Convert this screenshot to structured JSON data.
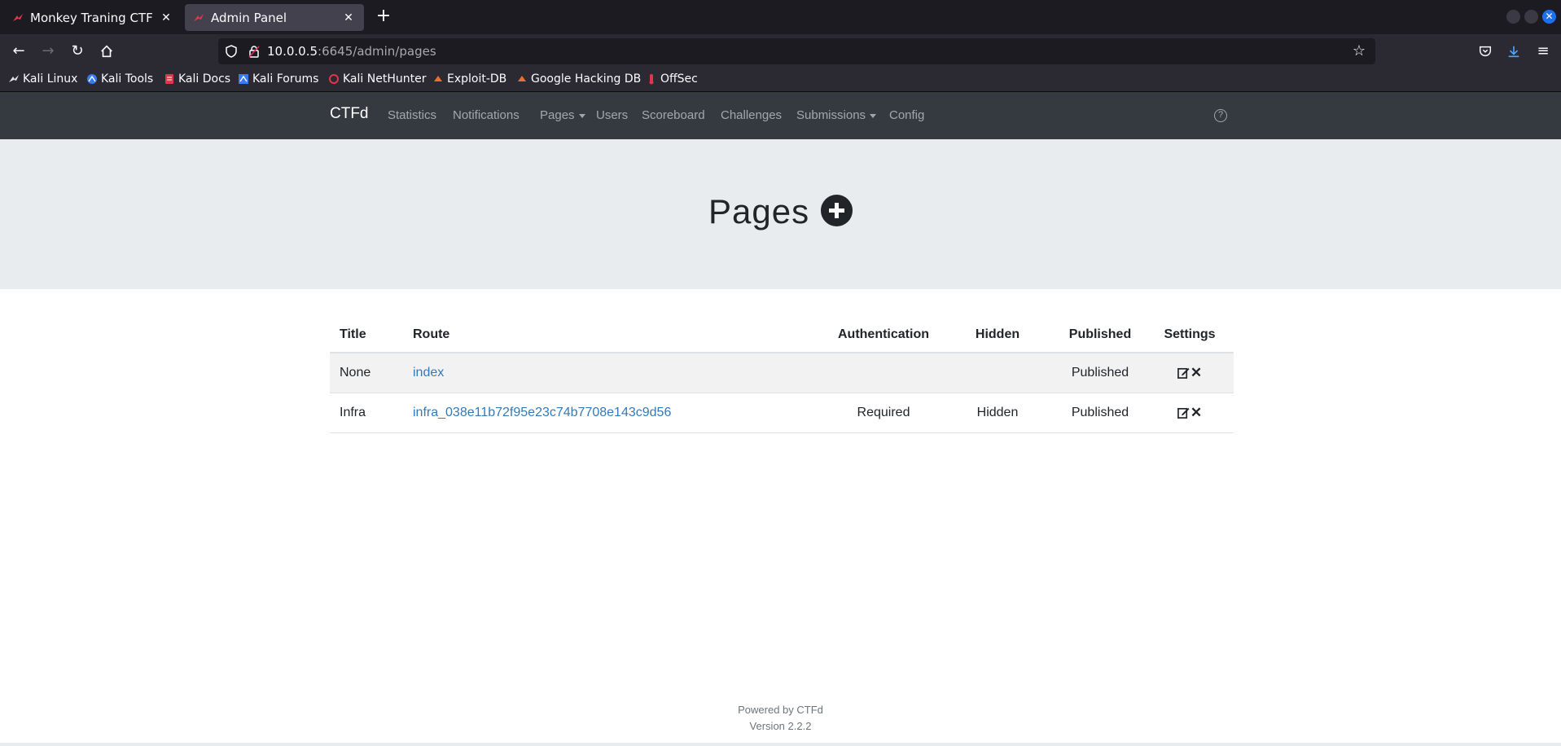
{
  "browser": {
    "tabs": [
      {
        "title": "Monkey Traning CTF",
        "active": false
      },
      {
        "title": "Admin Panel",
        "active": true
      }
    ],
    "new_tab": "+",
    "close_glyph": "✕",
    "url": {
      "host": "10.0.0.5",
      "rest": ":6645/admin/pages"
    },
    "bookmarks": [
      {
        "label": "Kali Linux",
        "icon": "kali-dragon-icon"
      },
      {
        "label": "Kali Tools",
        "icon": "kali-tools-icon"
      },
      {
        "label": "Kali Docs",
        "icon": "kali-docs-icon"
      },
      {
        "label": "Kali Forums",
        "icon": "kali-forums-icon"
      },
      {
        "label": "Kali NetHunter",
        "icon": "nethunter-icon"
      },
      {
        "label": "Exploit-DB",
        "icon": "exploit-db-icon"
      },
      {
        "label": "Google Hacking DB",
        "icon": "ghdb-icon"
      },
      {
        "label": "OffSec",
        "icon": "offsec-icon"
      }
    ]
  },
  "ctfd": {
    "brand": "CTFd",
    "nav": {
      "statistics": "Statistics",
      "notifications": "Notifications",
      "pages": "Pages",
      "users": "Users",
      "scoreboard": "Scoreboard",
      "challenges": "Challenges",
      "submissions": "Submissions",
      "config": "Config"
    },
    "help_glyph": "?",
    "heading": "Pages",
    "table": {
      "headers": {
        "title": "Title",
        "route": "Route",
        "authentication": "Authentication",
        "hidden": "Hidden",
        "published": "Published",
        "settings": "Settings"
      },
      "rows": [
        {
          "title": "None",
          "route": "index",
          "authentication": "",
          "hidden": "",
          "published": "Published"
        },
        {
          "title": "Infra",
          "route": "infra_038e11b72f95e23c74b7708e143c9d56",
          "authentication": "Required",
          "hidden": "Hidden",
          "published": "Published"
        }
      ],
      "delete_glyph": "✕"
    },
    "footer": {
      "powered": "Powered by CTFd",
      "version": "Version 2.2.2"
    }
  },
  "colors": {
    "navbar": "#343a40",
    "jumbotron": "#e9ecef",
    "link": "#337ab7",
    "browser_tabbar": "#1c1b22",
    "browser_toolbar": "#2b2a33"
  }
}
